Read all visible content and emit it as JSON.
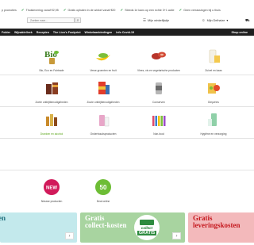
{
  "usp_bar": [
    "p promoties",
    "Thuislevering vanaf €2,95",
    "Gratis ophalen in de winkel vanaf €20",
    "Steeds 1e kans op een echte 3+1 actie",
    "Geen verrassingen bij u thuis"
  ],
  "search": {
    "placeholder": "Zoeken naar...",
    "button_icon": "search-icon"
  },
  "account": {
    "shopping_list": "Mijn winkellijstje",
    "account_label": "Mijn Delhaize",
    "cart_icon": "cart-icon"
  },
  "nav": {
    "items": [
      "Folder",
      "Wijnaktelleek",
      "Recepten",
      "The Lion's Footprint",
      "Winkelaanbiedingen",
      "Info Covid-19"
    ],
    "right": "Shop online"
  },
  "categories": [
    {
      "label": "Bio, Eco en Fairtrade",
      "icon": "bio-icon"
    },
    {
      "label": "Verse groenten en fruit",
      "icon": "banana-icon"
    },
    {
      "label": "Vlees, vis en vegetarische producten",
      "icon": "meat-icon"
    },
    {
      "label": "Zuivel en kaas",
      "icon": "dairy-icon"
    },
    {
      "label": "Zoete ontbijtbenodigdheden",
      "icon": "coffee-icon"
    },
    {
      "label": "Zoute ontbijtbenodigdheden",
      "icon": "crisps-icon"
    },
    {
      "label": "Conserven",
      "icon": "can-icon"
    },
    {
      "label": "Diepvries",
      "icon": "frozen-icon"
    },
    {
      "label": "Dranken en alcohol",
      "icon": "drinks-icon",
      "highlight": true
    },
    {
      "label": "Onderhoudsproducten",
      "icon": "cleaning-icon"
    },
    {
      "label": "Non-food",
      "icon": "nonfood-icon"
    },
    {
      "label": "Hygiëne en verzorging",
      "icon": "hygiene-icon"
    },
    {
      "label": "Nieuwe producten",
      "icon": "new-badge-icon",
      "badge_text": "NEW"
    },
    {
      "label": "Deal online",
      "icon": "deal-badge-icon",
      "badge_text": "50"
    }
  ],
  "banners": [
    {
      "title": "en",
      "color": "#c3e9ec"
    },
    {
      "title": "Gratis\ncollect-kosten",
      "badge_line1": "collect",
      "badge_line2": "GRATIS",
      "color": "#a8d4a0"
    },
    {
      "title": "Gratis\nleveringskosten",
      "color": "#f3b9bb"
    }
  ],
  "colors": {
    "nav_bg": "#1e1e1e",
    "check": "#1f8f3a",
    "highlight": "#5aa519"
  }
}
